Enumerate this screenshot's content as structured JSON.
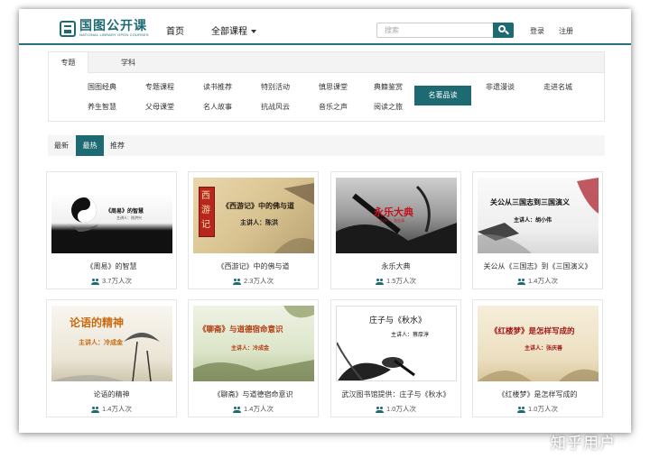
{
  "header": {
    "logo_cn": "国图公开课",
    "logo_en": "NATIONAL LIBRARY OPEN COURSES",
    "nav_home": "首页",
    "nav_courses": "全部课程",
    "search_placeholder": "搜索",
    "login": "登录",
    "register": "注册"
  },
  "panel": {
    "tabs": [
      {
        "label": "专题",
        "active": true
      },
      {
        "label": "学科",
        "active": false
      }
    ],
    "tags_row1": [
      "国图经典",
      "专题课程",
      "读书推荐",
      "特别活动",
      "慎思课堂",
      "典籍鉴赏",
      "名著品读",
      "非遗漫谈",
      "走进名城"
    ],
    "tags_row2": [
      "养生智慧",
      "父母课堂",
      "名人故事",
      "抗战风云",
      "音乐之声",
      "阅读之旅"
    ],
    "active_tag": "名著品读"
  },
  "sortbar": {
    "items": [
      "最新",
      "最热",
      "推荐"
    ],
    "active": "最热"
  },
  "cards": [
    {
      "title": "《周易》的智慧",
      "count": "3.7万人次",
      "img_title": "《周易》的智慧",
      "img_speaker": "主讲人：徐洪兴"
    },
    {
      "title": "《西游记》中的佛与道",
      "count": "2.3万人次",
      "img_title": "《西游记》中的佛与道",
      "img_speaker": "主讲人：陈洪",
      "img_side": "西游记"
    },
    {
      "title": "永乐大典",
      "count": "1.5万人次",
      "img_title": "永乐大典",
      "img_speaker": "主讲人：张志清"
    },
    {
      "title": "关公从《三国志》到《三国演义》",
      "count": "1.4万人次",
      "img_title": "关公从三国志到三国演义",
      "img_speaker": "主讲人：胡小伟"
    },
    {
      "title": "论语的精神",
      "count": "1.4万人次",
      "img_title": "论语的精神",
      "img_speaker": "主讲人：冷成金"
    },
    {
      "title": "《聊斋》与道德宿命意识",
      "count": "1.4万人次",
      "img_title": "《聊斋》与道德宿命意识",
      "img_speaker": "主讲人：冷成金"
    },
    {
      "title": "武汉图书馆提供：庄子与《秋水》",
      "count": "1.0万人次",
      "img_title": "庄子与《秋水》",
      "img_speaker": "主讲人：蔡厚淳"
    },
    {
      "title": "《红楼梦》是怎样写成的",
      "count": "1.0万人次",
      "img_title": "《红楼梦》是怎样写成的",
      "img_speaker": "主讲人：张庆善"
    }
  ],
  "watermark": "知乎用户",
  "colors": {
    "accent": "#1d6a73",
    "red": "#c0141e"
  }
}
